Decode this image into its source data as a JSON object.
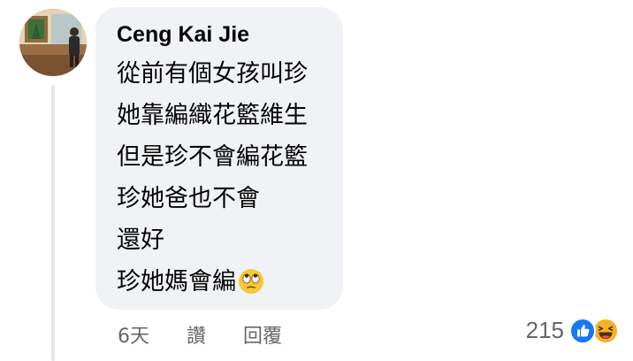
{
  "comment": {
    "author": "Ceng Kai Jie",
    "lines": [
      "從前有個女孩叫珍",
      "她靠編織花籃維生",
      "但是珍不會編花籃",
      "珍她爸也不會",
      "還好",
      "珍她媽會編"
    ],
    "trailing_emoji": "face-with-rolling-eyes-icon"
  },
  "actions": {
    "time": "6天",
    "like": "讚",
    "reply": "回覆"
  },
  "reactions": {
    "count": "215",
    "icons": [
      "like-reaction-icon",
      "haha-reaction-icon"
    ],
    "like_color": "#1877f2",
    "haha_color": "#f7b125"
  }
}
